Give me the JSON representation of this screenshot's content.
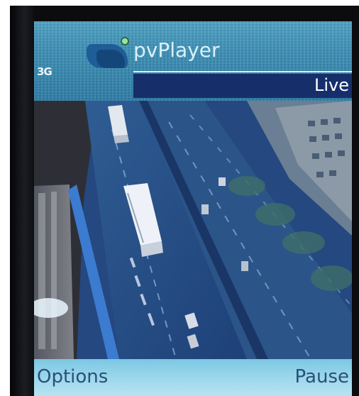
{
  "app": {
    "title": "pvPlayer",
    "status_indicator": "3G",
    "logo_icon": "pvplayer-logo-icon"
  },
  "stream": {
    "mode_label": "Live",
    "content_description": "street-traffic-camera-feed"
  },
  "softkeys": {
    "left_label": "Options",
    "right_label": "Pause"
  },
  "colors": {
    "header_teal": "#3d8fb5",
    "live_bar_navy": "#162f6b",
    "softkey_bar": "#9fd8ec",
    "softkey_text": "#2a4f78"
  }
}
